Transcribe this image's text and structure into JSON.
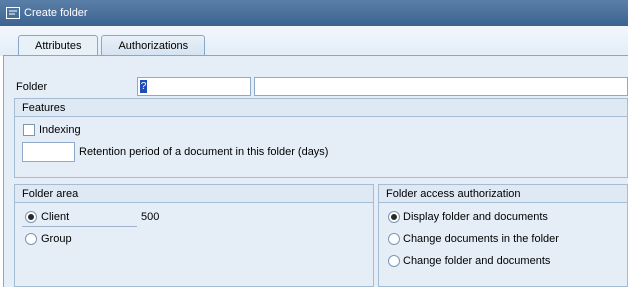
{
  "window": {
    "title": "Create folder"
  },
  "tabs": [
    {
      "label": "Attributes",
      "active": true
    },
    {
      "label": "Authorizations",
      "active": false
    }
  ],
  "folder": {
    "label": "Folder",
    "key_value": "?",
    "description_value": ""
  },
  "features": {
    "title": "Features",
    "indexing_label": "Indexing",
    "indexing_checked": false,
    "retention_value": "",
    "retention_label": "Retention period of a document in this folder (days)"
  },
  "folder_area": {
    "title": "Folder area",
    "options": [
      {
        "label": "Client",
        "selected": true,
        "value": "500"
      },
      {
        "label": "Group",
        "selected": false
      }
    ]
  },
  "access": {
    "title": "Folder access authorization",
    "options": [
      {
        "label": "Display folder and documents",
        "selected": true
      },
      {
        "label": "Change documents in the folder",
        "selected": false
      },
      {
        "label": "Change folder and documents",
        "selected": false
      }
    ]
  },
  "colors": {
    "titlebar": "#3c6391",
    "panel": "#e5eef7",
    "border": "#8aa7c7"
  }
}
